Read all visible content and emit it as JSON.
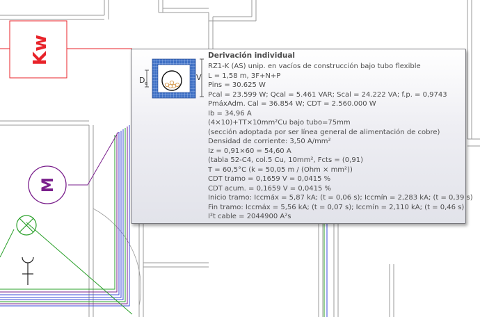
{
  "drawing": {
    "panel_label": "Kw",
    "motor_label": "M"
  },
  "tooltip": {
    "title": "Derivación individual",
    "section_labels": {
      "diameter": "D",
      "diameter_sub": "e",
      "height": "V"
    },
    "lines": [
      "RZ1-K (AS) unip. en vacíos de construcción bajo tubo flexible",
      "L = 1,58 m, 3F+N+P",
      "Pins = 30.625 W",
      "Pcal = 23.599 W; Qcal = 5.461 VAR; Scal = 24.222 VA; f.p. = 0,9743",
      "PmáxAdm. Cal = 36.854 W; CDT = 2.560.000 W",
      "Ib = 34,96 A",
      "(4×10)+TT×10mm²Cu bajo tubo=75mm",
      "(sección adoptada por ser línea general de alimentación de cobre)",
      "Densidad de corriente: 3,50 A/mm²",
      "Iz = 0,91×60 = 54,60 A",
      "(tabla 52-C4, col.5 Cu, 10mm², Fcts = (0,91)",
      "T = 60,5°C (k = 50,05 m / (Ohm × mm²))",
      "CDT tramo = 0,1659 V = 0,0415 %",
      "CDT acum. = 0,1659 V = 0,0415 %",
      "Inicio tramo: Iccmáx = 5,87 kA; (t = 0,06 s); Iccmín = 2,283 kA; (t = 0,39 s)",
      "Fin tramo: Iccmáx = 5,56 kA; (t = 0,07 s); Iccmín = 2,110 kA; (t = 0,46 s)",
      "I²t cable = 2044900 A²s"
    ]
  },
  "colors": {
    "wall": "#9a9a9a",
    "panel": "#e8232a",
    "motor": "#7a1f8c",
    "lamp": "#2fbf2f",
    "cable_blue": "#3b4bd8",
    "cable_green": "#2aa02a",
    "cable_purple": "#7a1f8c"
  }
}
